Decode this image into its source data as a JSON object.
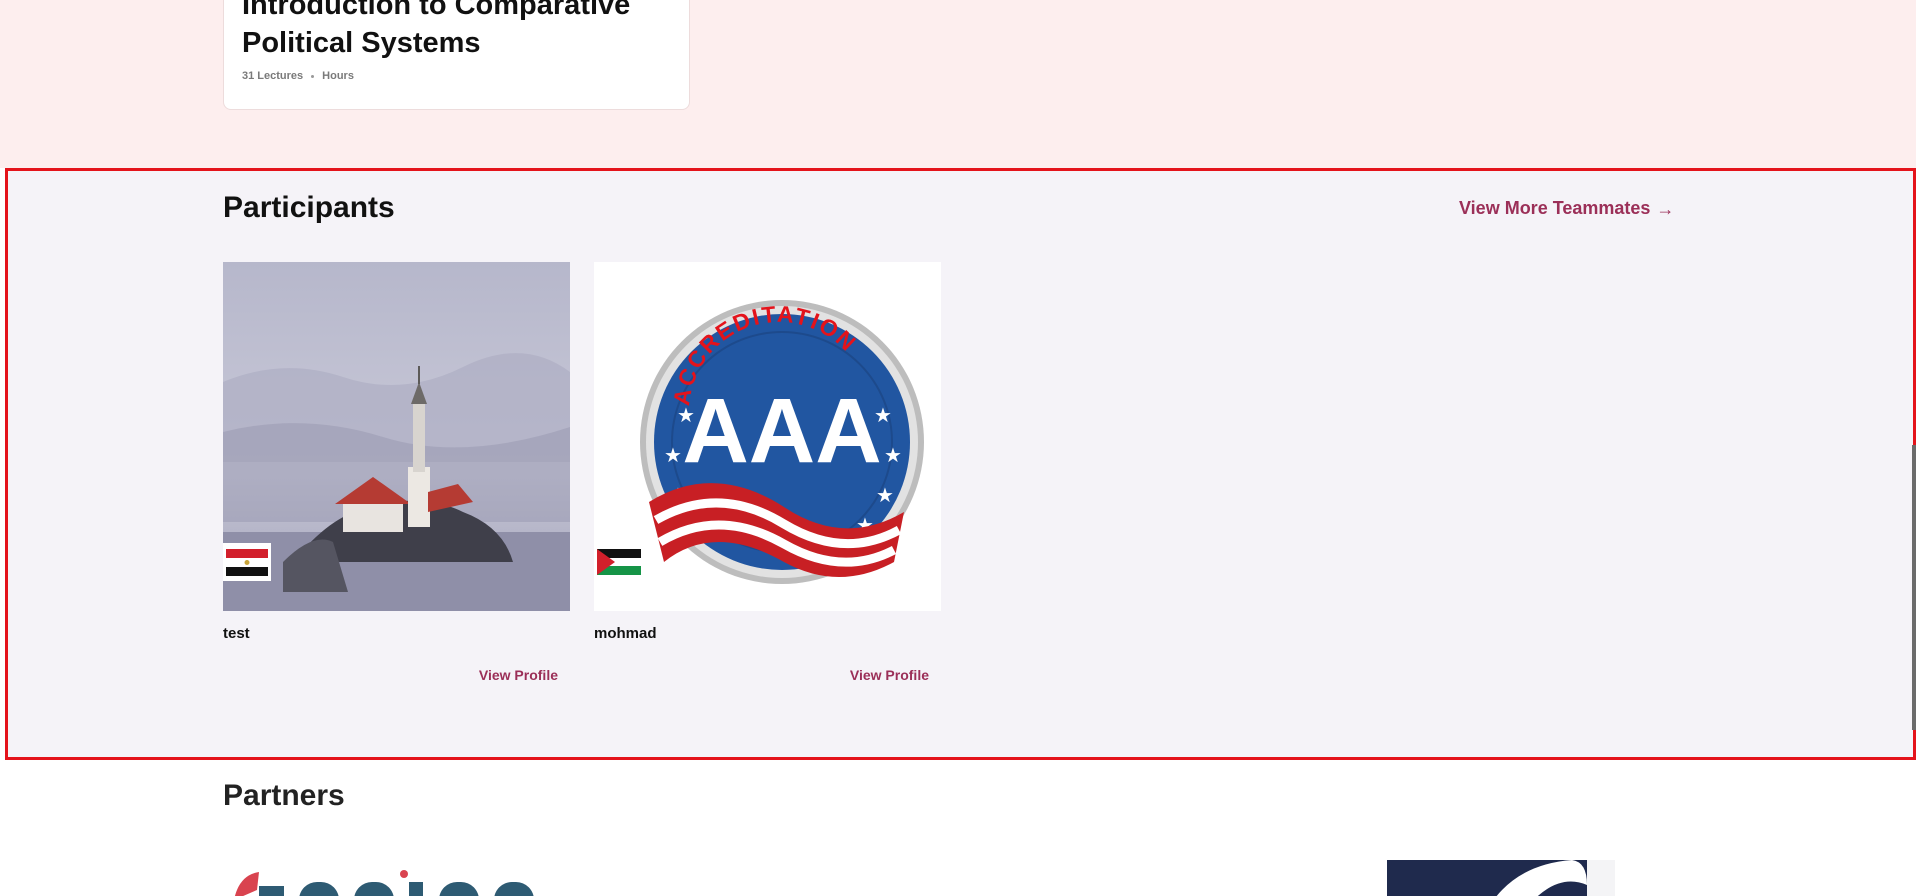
{
  "course": {
    "title": "Introduction to Comparative Political Systems",
    "lectures": "31 Lectures",
    "hours": "Hours"
  },
  "participants": {
    "title": "Participants",
    "view_more_label": "View More Teammates",
    "view_more_icon": "arrow-right-icon",
    "items": [
      {
        "name": "test",
        "view_profile_label": "View Profile",
        "flag": "egypt-flag-icon"
      },
      {
        "name": "mohmad",
        "view_profile_label": "View Profile",
        "flag": "palestine-flag-icon",
        "badge": {
          "arc_text": "ACCREDITATION",
          "letters": "AAA"
        }
      }
    ]
  },
  "partners": {
    "title": "Partners",
    "logos": [
      "trainees-logo",
      "partner-logo-navy"
    ]
  },
  "colors": {
    "accent": "#9b2f58",
    "highlight_border": "#e4131b",
    "course_bg": "#fdeeee",
    "participants_bg": "#f5f3f8"
  }
}
